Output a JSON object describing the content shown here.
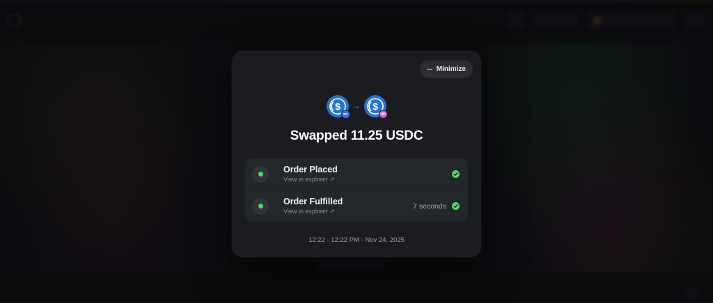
{
  "modal": {
    "minimize_label": "Minimize",
    "title": "Swapped 11.25 USDC",
    "tokens": [
      {
        "icon": "usdc-coin-icon",
        "color": "#2775ca",
        "badge_color": "#3a6ff0"
      },
      {
        "icon": "usdc-coin-icon",
        "color": "#2775ca",
        "badge_color": "#c24fd6"
      }
    ],
    "arrow": "→",
    "steps": [
      {
        "label": "Order Placed",
        "link": "View in explorer ↗",
        "duration": "",
        "status": "complete"
      },
      {
        "label": "Order Fulfilled",
        "link": "View in explorer ↗",
        "duration": "7 seconds",
        "status": "complete"
      }
    ],
    "timestamp": "12:22 - 12:22 PM · Nov 24, 2025"
  },
  "colors": {
    "success": "#4cd964",
    "modal_bg": "#1b1c20",
    "card_bg": "#23262b"
  }
}
